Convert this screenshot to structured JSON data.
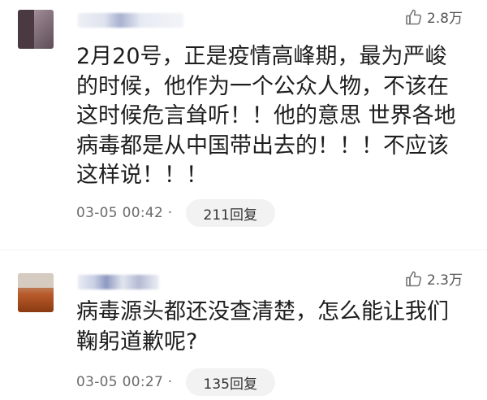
{
  "comments": [
    {
      "likes": "2.8万",
      "text": "2月20号，正是疫情高峰期，最为严峻的时候，他作为一个公众人物，不该在这时候危言耸听！！他的意思 世界各地病毒都是从中国带出去的！！！不应该这样说！！！",
      "time": "03-05 00:42 ·",
      "replies": "211回复"
    },
    {
      "likes": "2.3万",
      "text": "病毒源头都还没查清楚，怎么能让我们鞠躬道歉呢?",
      "time": "03-05 00:27 ·",
      "replies": "135回复"
    }
  ],
  "colors": {
    "text": "#1e1e1e",
    "meta": "#6b6b6b",
    "pill_bg": "#f2f2f2"
  },
  "icons": {
    "like": "thumbs-up-icon"
  }
}
